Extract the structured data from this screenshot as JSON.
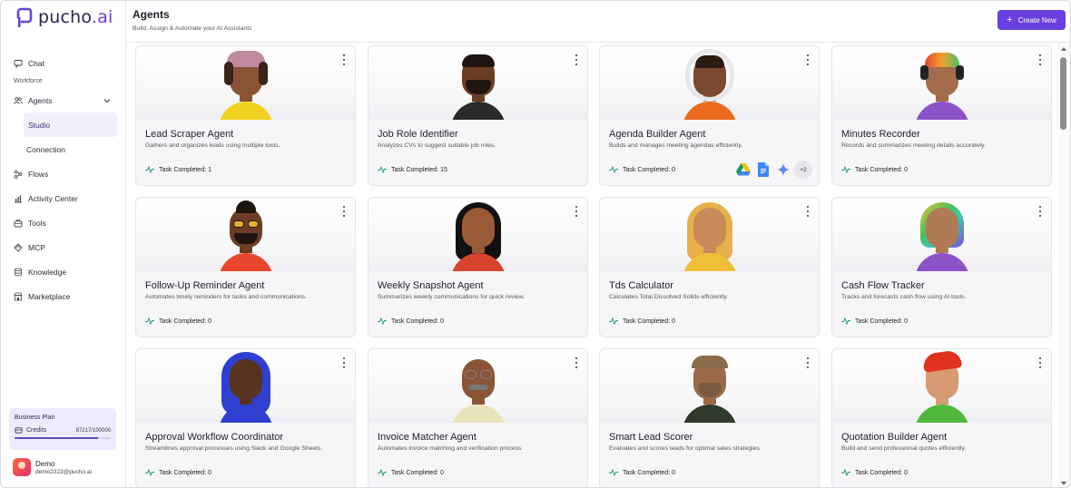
{
  "brand": {
    "name": "pucho",
    "suffix": ".ai",
    "accent": "#6a3fe0"
  },
  "sidebar": {
    "chat": "Chat",
    "section_workforce": "Workforce",
    "agents": "Agents",
    "studio": "Studio",
    "connection": "Connection",
    "flows": "Flows",
    "activity_center": "Activity Center",
    "tools": "Tools",
    "mcp": "MCP",
    "knowledge": "Knowledge",
    "marketplace": "Marketplace"
  },
  "plan": {
    "title": "Business Plan",
    "credits_label": "Credits",
    "credits_value": "87217/100000",
    "credits_fraction": 0.872
  },
  "user": {
    "name": "Demo",
    "email": "demo2222@pucho.ai"
  },
  "header": {
    "title": "Agents",
    "subtitle": "Build, Assign & Automate your AI Assistants",
    "create_label": "Create New"
  },
  "task_label": "Task Completed:",
  "agents": [
    {
      "name": "Lead Scraper Agent",
      "desc": "Gathers and organizes leads using multiple tools.",
      "tasks": "1",
      "figure": "beret",
      "tools": []
    },
    {
      "name": "Job Role Identifier",
      "desc": "Analyzes CVs to suggest suitable job roles.",
      "tasks": "15",
      "figure": "suit",
      "tools": []
    },
    {
      "name": "Agenda Builder Agent",
      "desc": "Builds and manages meeting agendas efficiently.",
      "tasks": "0",
      "figure": "astronaut",
      "tools": [
        "google-drive-icon",
        "google-docs-icon",
        "gemini-icon"
      ],
      "more_tools": "+2"
    },
    {
      "name": "Minutes Recorder",
      "desc": "Records and summarizes meeting details accurately.",
      "tasks": "0",
      "figure": "headphones",
      "tools": []
    },
    {
      "name": "Follow-Up Reminder Agent",
      "desc": "Automates timely reminders for tasks and communications.",
      "tasks": "0",
      "figure": "sunglasses",
      "tools": []
    },
    {
      "name": "Weekly Snapshot Agent",
      "desc": "Summarizes weekly communications for quick review.",
      "tasks": "0",
      "figure": "longhair",
      "tools": []
    },
    {
      "name": "Tds Calculator",
      "desc": "Calculates Total Dissolved Solids efficiently.",
      "tasks": "0",
      "figure": "blonde",
      "tools": []
    },
    {
      "name": "Cash Flow Tracker",
      "desc": "Tracks and forecasts cash flow using AI tools.",
      "tasks": "0",
      "figure": "rainbow",
      "tools": []
    },
    {
      "name": "Approval Workflow Coordinator",
      "desc": "Streamlines approval processes using Slack and Google Sheets.",
      "tasks": "0",
      "figure": "hijab",
      "tools": []
    },
    {
      "name": "Invoice Matcher Agent",
      "desc": "Automates invoice matching and verification process.",
      "tasks": "0",
      "figure": "glasses",
      "tools": []
    },
    {
      "name": "Smart Lead Scorer",
      "desc": "Evaluates and scores leads for optimal sales strategies.",
      "tasks": "0",
      "figure": "cap",
      "tools": []
    },
    {
      "name": "Quotation Builder Agent",
      "desc": "Build and send professional quotes efficiently.",
      "tasks": "0",
      "figure": "redhair",
      "tools": []
    }
  ]
}
